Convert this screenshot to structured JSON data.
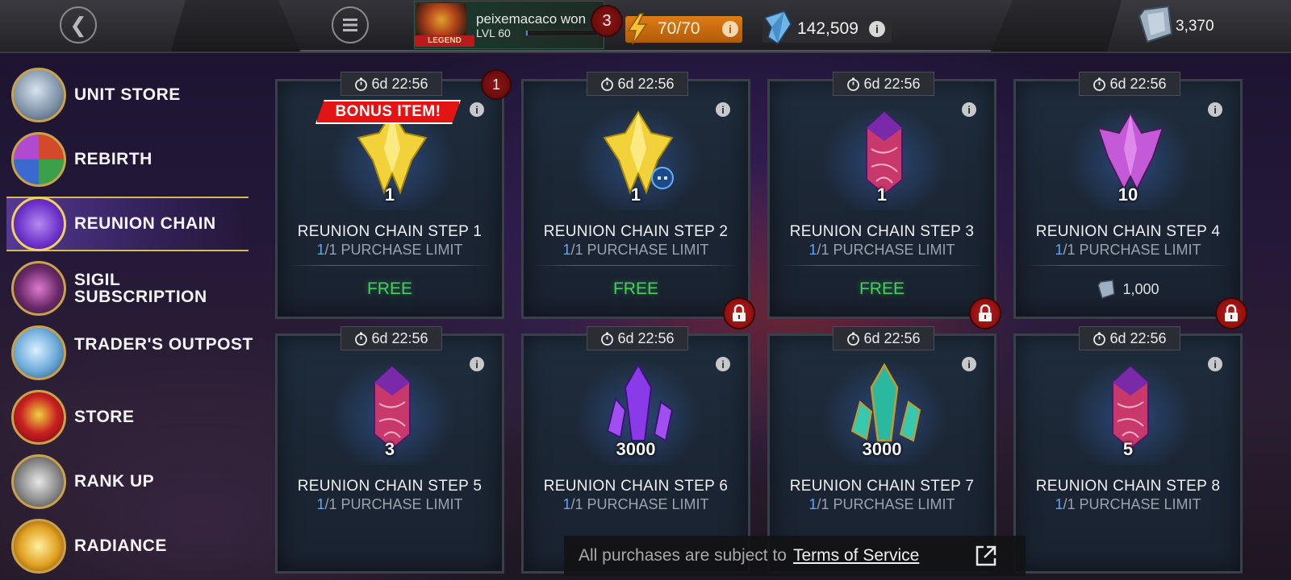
{
  "header": {
    "back_icon": "chevron-left-icon",
    "menu_icon": "hamburger-menu-icon",
    "player": {
      "name": "peixemacaco won",
      "level": "LVL 60",
      "rank_tag": "LEGEND",
      "xp_progress": 0.02,
      "notifications": "3"
    },
    "energy": {
      "value": "70/70",
      "info": "i",
      "color": "#e07c14"
    },
    "crystals": {
      "value": "142,509",
      "info": "i"
    },
    "units": {
      "value": "3,370"
    }
  },
  "sidebar": {
    "items": [
      {
        "label": "UNIT STORE",
        "icon": "unit-stone-icon",
        "active": false
      },
      {
        "label": "REBIRTH",
        "icon": "rebirth-icon",
        "active": false
      },
      {
        "label": "REUNION CHAIN",
        "icon": "reunion-chain-icon",
        "active": true
      },
      {
        "label": "SIGIL SUBSCRIPTION",
        "icon": "sigil-icon",
        "active": false
      },
      {
        "label": "TRADER'S OUTPOST",
        "icon": "crystal-shard-icon",
        "active": false
      },
      {
        "label": "STORE",
        "icon": "store-fist-icon",
        "active": false
      },
      {
        "label": "RANK UP",
        "icon": "rank-up-arrow-icon",
        "active": false
      },
      {
        "label": "RADIANCE",
        "icon": "radiance-icon",
        "active": false
      }
    ]
  },
  "cards": [
    {
      "timer": "6d 22:56",
      "qty": "1",
      "title": "REUNION CHAIN STEP 1",
      "limit_current": "1",
      "limit_text": "/1 PURCHASE LIMIT",
      "price": "FREE",
      "locked": false,
      "bonus": "BONUS ITEM!",
      "badge": "1",
      "item": "gold-crystal"
    },
    {
      "timer": "6d 22:56",
      "qty": "1",
      "title": "REUNION CHAIN STEP 2",
      "limit_current": "1",
      "limit_text": "/1 PURCHASE LIMIT",
      "price": "FREE",
      "locked": true,
      "item": "gold-crystal-badge"
    },
    {
      "timer": "6d 22:56",
      "qty": "1",
      "title": "REUNION CHAIN STEP 3",
      "limit_current": "1",
      "limit_text": "/1 PURCHASE LIMIT",
      "price": "FREE",
      "locked": true,
      "item": "pink-crystal"
    },
    {
      "timer": "6d 22:56",
      "qty": "10",
      "title": "REUNION CHAIN STEP 4",
      "limit_current": "1",
      "limit_text": "/1 PURCHASE LIMIT",
      "price_units": "1,000",
      "locked": true,
      "item": "purple-crystal"
    },
    {
      "timer": "6d 22:56",
      "qty": "3",
      "title": "REUNION CHAIN STEP 5",
      "limit_current": "1",
      "limit_text": "/1 PURCHASE LIMIT",
      "item": "pink-crystal"
    },
    {
      "timer": "6d 22:56",
      "qty": "3000",
      "title": "REUNION CHAIN STEP 6",
      "limit_current": "1",
      "limit_text": "/1 PURCHASE LIMIT",
      "item": "violet-shards"
    },
    {
      "timer": "6d 22:56",
      "qty": "3000",
      "title": "REUNION CHAIN STEP 7",
      "limit_current": "1",
      "limit_text": "/1 PURCHASE LIMIT",
      "item": "teal-shards"
    },
    {
      "timer": "6d 22:56",
      "qty": "5",
      "title": "REUNION CHAIN STEP 8",
      "limit_current": "1",
      "limit_text": "/1 PURCHASE LIMIT",
      "item": "pink-crystal"
    }
  ],
  "footer": {
    "prefix": "All purchases are subject to",
    "link": "Terms of Service",
    "external_icon": "external-link-icon"
  }
}
